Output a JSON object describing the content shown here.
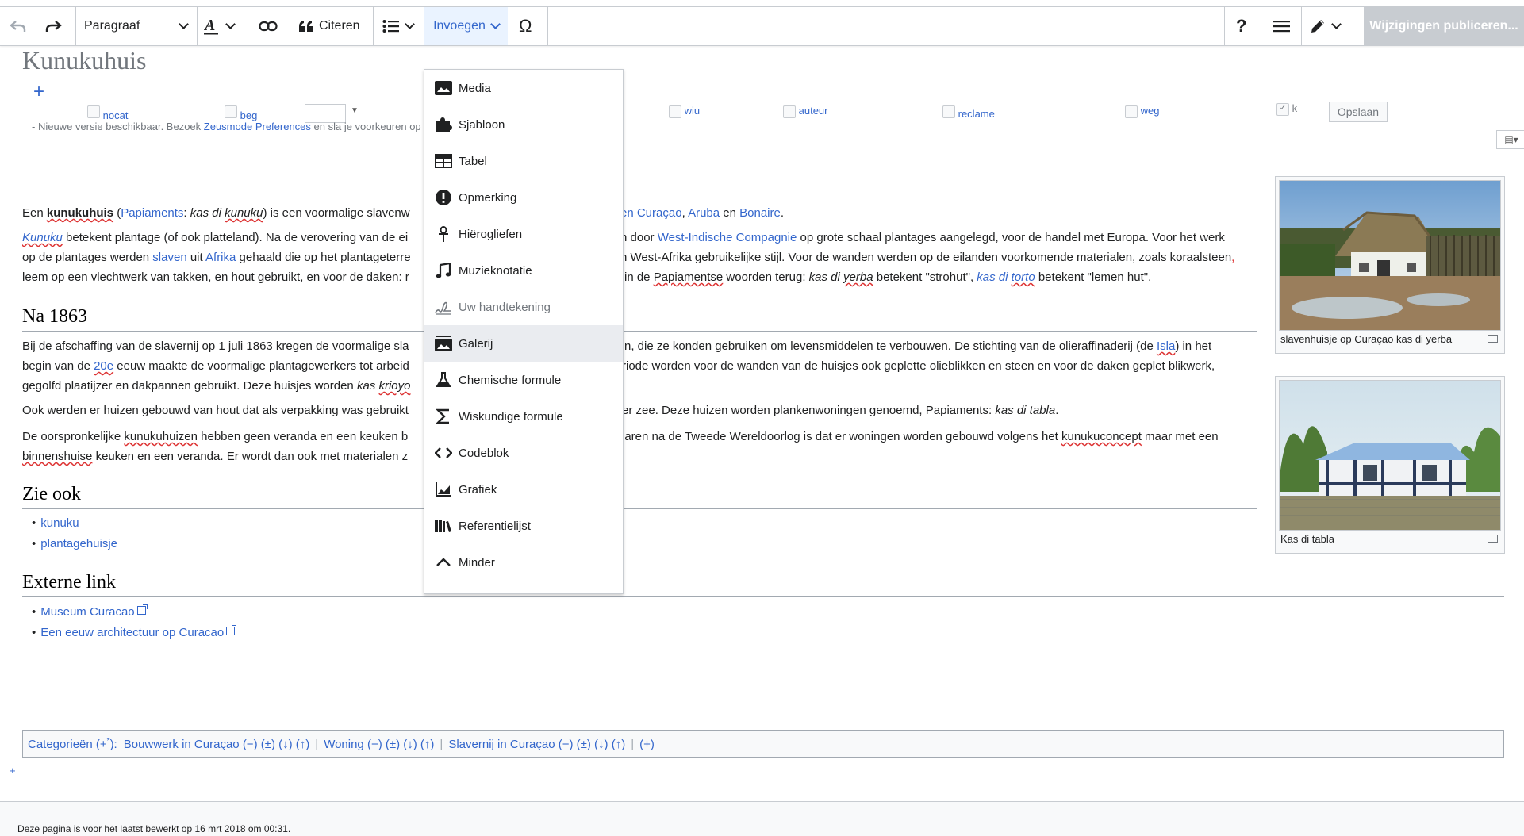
{
  "toolbar": {
    "paragraph": "Paragraaf",
    "cite": "Citeren",
    "insert": "Invoegen",
    "special_char": "Ω",
    "help": "?",
    "publish": "Wijzigingen publiceren..."
  },
  "page": {
    "title": "Kunukuhuis",
    "add": "+"
  },
  "gadgets": {
    "items": [
      "nocat",
      "beg",
      "wiu",
      "auteur",
      "reclame",
      "weg",
      "k"
    ],
    "save": "Opslaan",
    "notice_prefix": "- Nieuwe versie beschikbaar. Bezoek ",
    "notice_link": "Zeusmode Preferences",
    "notice_suffix": " en sla je voorkeuren op"
  },
  "insert_menu": {
    "items": [
      "Media",
      "Sjabloon",
      "Tabel",
      "Opmerking",
      "Hiërogliefen",
      "Muzieknotatie",
      "Uw handtekening",
      "Galerij",
      "Chemische formule",
      "Wiskundige formule",
      "Codeblok",
      "Grafiek",
      "Referentielijst",
      "Minder"
    ]
  },
  "article": {
    "p1": [
      "Een ",
      "kunukuhuis",
      " (",
      "Papiaments",
      ": ",
      "kas di ",
      "kunuku",
      ") is een voormalige slavenw",
      "en Curaçao",
      ", ",
      "Aruba",
      " en ",
      "Bonaire",
      "."
    ],
    "p2a": [
      "Kunuku",
      " betekent plantage (of ook platteland). Na de verovering van de ei",
      "n door ",
      "West-Indische Compagnie",
      " op grote schaal plantages aangelegd, voor de handel met Europa. Voor het werk"
    ],
    "p2b": [
      "op de plantages werden ",
      "slaven",
      " uit ",
      "Afrika",
      " gehaald die op het plantageterre",
      "n West-Afrika gebruikelijke stijl. Voor de wanden werden op de eilanden voorkomende materialen, zoals ",
      "koraalsteen",
      ","
    ],
    "p2c": [
      "leem op een vlechtwerk van takken, en hout gebruikt, en voor de daken: r",
      "in de ",
      "Papiamentse",
      " woorden terug: ",
      "kas di ",
      "yerba",
      " betekent \"strohut\", ",
      "kas di ",
      "torto",
      " betekent \"lemen hut\"."
    ],
    "h_na1863": "Na 1863",
    "p3a": [
      "Bij de afschaffing van de slavernij op 1 juli 1863 kregen de voormalige sla",
      "n, die ze konden gebruiken om levensmiddelen te verbouwen. De stichting van de olieraffinaderij (de ",
      "Isla",
      ") in het"
    ],
    "p3b": [
      "begin van de ",
      "20e",
      " eeuw maakte de voormalige plantagewerkers tot arbeid",
      "riode worden voor de wanden van de huisjes ook geplette olieblikken en steen en voor de daken geplet blikwerk,"
    ],
    "p3c": [
      "gegolfd plaatijzer en dakpannen gebruikt. Deze huisjes worden ",
      "kas ",
      "krioyo"
    ],
    "p4": [
      "Ook werden er huizen gebouwd van hout dat als verpakking was gebruikt",
      "er zee. Deze huizen worden plankenwoningen genoemd, Papiaments: ",
      "kas di tabla",
      "."
    ],
    "p5a": [
      "De oorspronkelijke ",
      "kunukuhuizen",
      " hebben geen veranda en een keuken b",
      "jaren na de Tweede Wereldoorlog is dat er woningen worden gebouwd volgens het ",
      "kunukuconcept",
      " maar met een"
    ],
    "p5b": [
      "binnenshuise",
      " keuken en een veranda. Er wordt dan ook met  materialen z"
    ],
    "h_zieook": "Zie ook",
    "zieook": [
      "kunuku",
      "plantagehuisje"
    ],
    "h_extern": "Externe link",
    "extern": [
      "Museum Curacao",
      "Een eeuw architectuur op Curacao"
    ]
  },
  "thumbs": [
    {
      "caption": "slavenhuisje op Curaçao kas di yerba"
    },
    {
      "caption": "Kas di tabla"
    }
  ],
  "categories": {
    "label": "Categorieën (+",
    "label_sup": "*",
    "label_end": "):",
    "items": [
      "Bouwwerk in Curaçao",
      "Woning",
      "Slavernij in Curaçao"
    ],
    "controls": "(−) (±) (↓) (↑)",
    "add": "(+)"
  },
  "footer": {
    "plus": "+",
    "text": "Deze pagina is voor het laatst bewerkt op 16 mrt 2018 om 00:31."
  }
}
